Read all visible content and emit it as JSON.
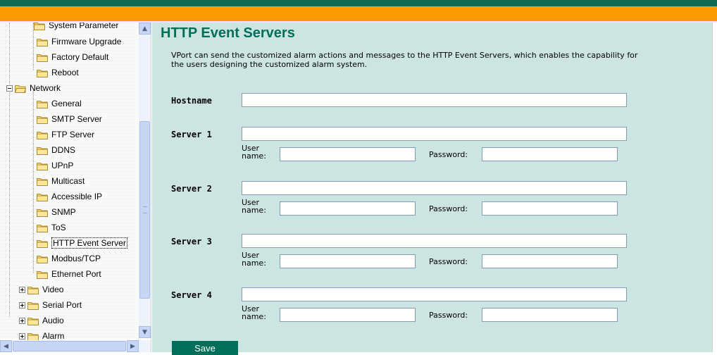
{
  "colors": {
    "header_green": "#0f6b4e",
    "header_orange": "#f99b00",
    "content_bg": "#cce5e0",
    "title_color": "#006f5a",
    "button_bg": "#006f5a"
  },
  "tree": {
    "items": [
      {
        "label": "System Parameter",
        "type": "folder"
      },
      {
        "label": "Firmware Upgrade",
        "type": "folder"
      },
      {
        "label": "Factory Default",
        "type": "folder"
      },
      {
        "label": "Reboot",
        "type": "folder"
      },
      {
        "label": "Network",
        "type": "folder-open"
      },
      {
        "label": "General",
        "type": "folder"
      },
      {
        "label": "SMTP Server",
        "type": "folder"
      },
      {
        "label": "FTP Server",
        "type": "folder"
      },
      {
        "label": "DDNS",
        "type": "folder"
      },
      {
        "label": "UPnP",
        "type": "folder"
      },
      {
        "label": "Multicast",
        "type": "folder"
      },
      {
        "label": "Accessible IP",
        "type": "folder"
      },
      {
        "label": "SNMP",
        "type": "folder"
      },
      {
        "label": "ToS",
        "type": "folder"
      },
      {
        "label": "HTTP Event Server",
        "type": "folder",
        "selected": true
      },
      {
        "label": "Modbus/TCP",
        "type": "folder"
      },
      {
        "label": "Ethernet Port",
        "type": "folder"
      },
      {
        "label": "Video",
        "type": "folder-collapsed"
      },
      {
        "label": "Serial Port",
        "type": "folder-collapsed"
      },
      {
        "label": "Audio",
        "type": "folder-collapsed"
      },
      {
        "label": "Alarm",
        "type": "folder-collapsed"
      }
    ]
  },
  "main": {
    "title": "HTTP Event Servers",
    "description": "VPort can send the customized alarm actions and messages to the HTTP Event Servers, which enables the capability for the users designing the customized alarm system.",
    "hostname": {
      "label": "Hostname",
      "value": ""
    },
    "servers": [
      {
        "label": "Server 1",
        "value": "",
        "user_label": "User name:",
        "user_value": "",
        "password_label": "Password:",
        "password_value": ""
      },
      {
        "label": "Server 2",
        "value": "",
        "user_label": "User name:",
        "user_value": "",
        "password_label": "Password:",
        "password_value": ""
      },
      {
        "label": "Server 3",
        "value": "",
        "user_label": "User name:",
        "user_value": "",
        "password_label": "Password:",
        "password_value": ""
      },
      {
        "label": "Server 4",
        "value": "",
        "user_label": "User name:",
        "user_value": "",
        "password_label": "Password:",
        "password_value": ""
      }
    ],
    "user_label_line1": "User",
    "user_label_line2": "name:",
    "save_label": "Save"
  },
  "scrollbar_icons": {
    "up": "chevron-up-icon",
    "down": "chevron-down-icon",
    "left": "chevron-left-icon",
    "right": "chevron-right-icon"
  }
}
